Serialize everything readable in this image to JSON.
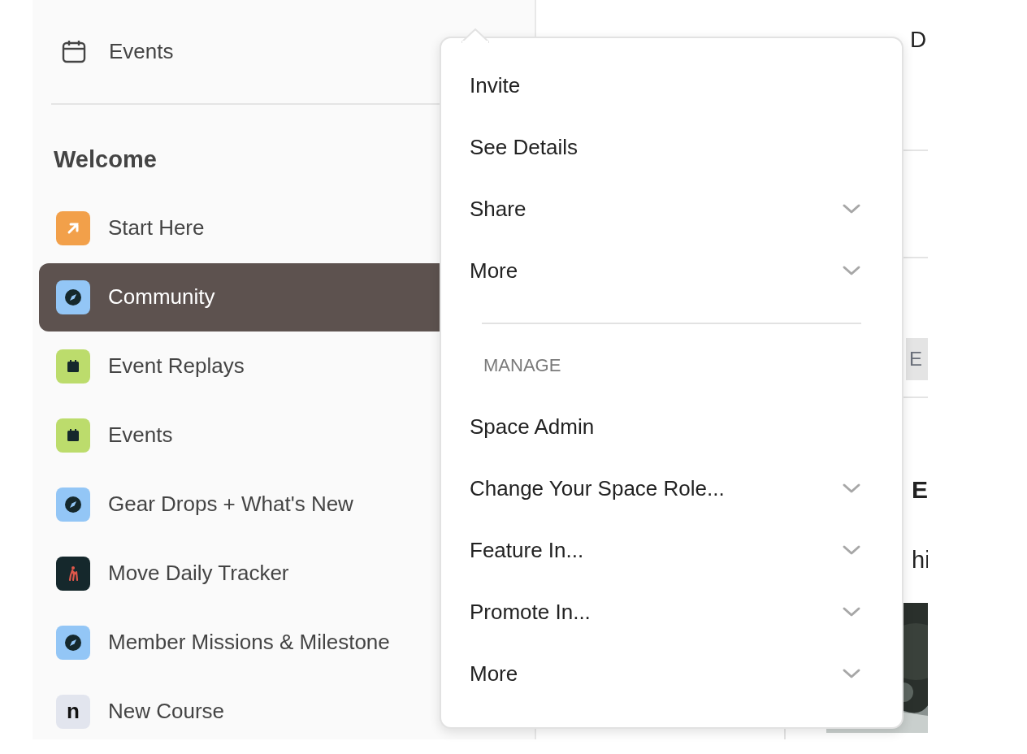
{
  "sidebar": {
    "top_link": {
      "label": "Events"
    },
    "section_title": "Welcome",
    "items": [
      {
        "label": "Start Here",
        "kind": "arrow",
        "color": "#f2a04a",
        "selected": false
      },
      {
        "label": "Community",
        "kind": "compass",
        "color": "#93c6f6",
        "selected": true
      },
      {
        "label": "Event Replays",
        "kind": "calendar",
        "color": "#bcdc6c",
        "selected": false
      },
      {
        "label": "Events",
        "kind": "calendar",
        "color": "#bcdc6c",
        "selected": false
      },
      {
        "label": "Gear Drops + What's New",
        "kind": "compass",
        "color": "#93c6f6",
        "selected": false
      },
      {
        "label": "Move Daily Tracker",
        "kind": "hiker",
        "color": "#15282c",
        "selected": false
      },
      {
        "label": "Member Missions & Milestone",
        "kind": "compass",
        "color": "#93c6f6",
        "selected": false
      },
      {
        "label": "New Course",
        "kind": "letter",
        "glyph": "n",
        "color": "#e2e5ee",
        "selected": false
      }
    ]
  },
  "menu": {
    "items": [
      {
        "label": "Invite",
        "kind": "action"
      },
      {
        "label": "See Details",
        "kind": "action"
      },
      {
        "label": "Share",
        "kind": "submenu"
      },
      {
        "label": "More",
        "kind": "submenu"
      }
    ],
    "section_title": "MANAGE",
    "manage_items": [
      {
        "label": "Space Admin",
        "kind": "action"
      },
      {
        "label": "Change Your Space Role...",
        "kind": "submenu"
      },
      {
        "label": "Feature In...",
        "kind": "submenu"
      },
      {
        "label": "Promote In...",
        "kind": "submenu"
      },
      {
        "label": "More",
        "kind": "submenu"
      }
    ]
  },
  "main": {
    "tab": "D",
    "chip": "E",
    "heading": "E",
    "text": "hi"
  }
}
